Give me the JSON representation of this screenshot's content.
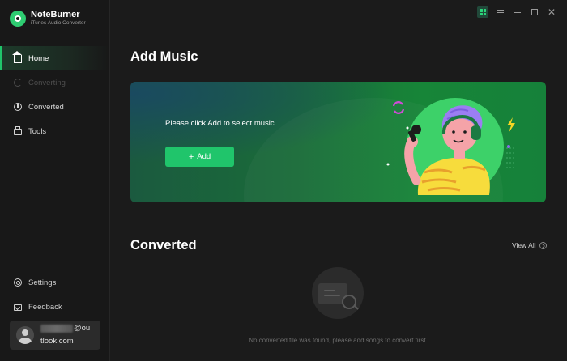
{
  "app": {
    "name": "NoteBurner",
    "subtitle": "iTunes Audio Converter",
    "accent": "#20c56b"
  },
  "sidebar": {
    "items": [
      {
        "label": "Home",
        "icon": "home-icon",
        "active": true
      },
      {
        "label": "Converting",
        "icon": "converting-icon",
        "disabled": true
      },
      {
        "label": "Converted",
        "icon": "clock-icon"
      },
      {
        "label": "Tools",
        "icon": "toolbox-icon"
      }
    ],
    "bottom": [
      {
        "label": "Settings",
        "icon": "settings-icon"
      },
      {
        "label": "Feedback",
        "icon": "feedback-icon"
      }
    ],
    "account": {
      "email_suffix": "@ou",
      "email_line2": "tlook.com"
    }
  },
  "titlebar": {
    "close_glyph": "✕"
  },
  "main": {
    "add_music_title": "Add Music",
    "banner_text": "Please click Add to select music",
    "add_button": {
      "icon": "+",
      "label": "Add"
    },
    "converted_title": "Converted",
    "view_all": "View All",
    "empty_message": "No converted file was found, please add songs to convert first."
  }
}
